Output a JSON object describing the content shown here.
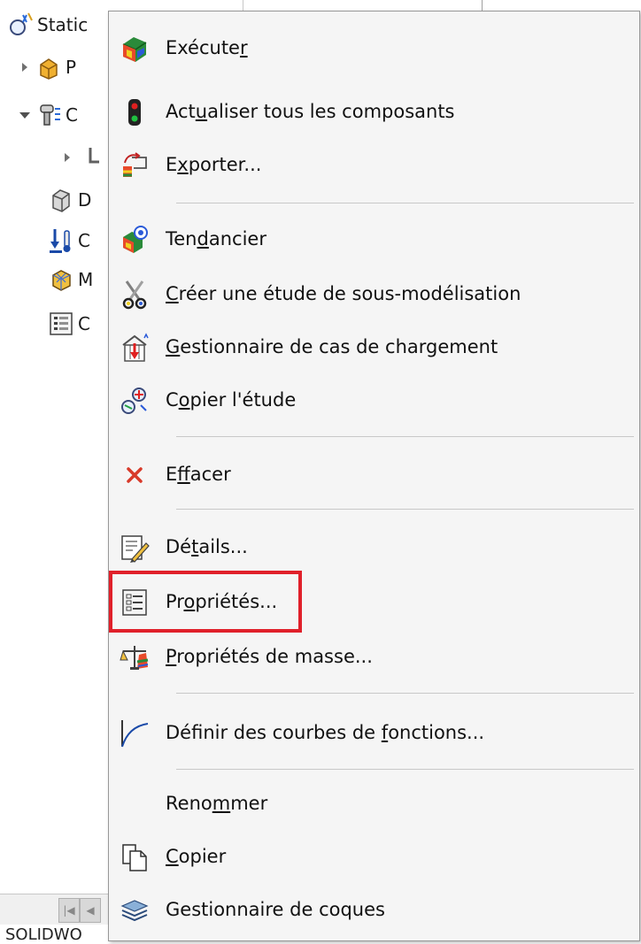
{
  "tree": {
    "title": "Static",
    "rows": [
      {
        "label": "P"
      },
      {
        "label": "C"
      },
      {
        "label": ""
      },
      {
        "label": "D"
      },
      {
        "label": "C"
      },
      {
        "label": "M"
      },
      {
        "label": "C"
      }
    ]
  },
  "status_bar": {
    "text": "SOLIDWO"
  },
  "menu": {
    "items": {
      "executer": {
        "pre": "Exécute",
        "key": "r",
        "post": "",
        "icon": "run-study-icon"
      },
      "actualiser": {
        "pre": "Act",
        "key": "u",
        "post": "aliser tous les composants",
        "icon": "traffic-light-icon"
      },
      "exporter": {
        "pre": "E",
        "key": "x",
        "post": "porter...",
        "icon": "export-icon"
      },
      "tendancier": {
        "pre": "Ten",
        "key": "d",
        "post": "ancier",
        "icon": "trend-tracker-icon"
      },
      "sousmodel": {
        "pre": "",
        "key": "C",
        "post": "réer une étude de sous-modélisation",
        "icon": "scissors-icon"
      },
      "gestcas": {
        "pre": "",
        "key": "G",
        "post": "estionnaire de cas de chargement",
        "icon": "load-case-manager-icon"
      },
      "copieretude": {
        "pre": "C",
        "key": "o",
        "post": "pier l'étude",
        "icon": "copy-study-icon"
      },
      "effacer": {
        "pre": "E",
        "key": "f",
        "post": "facer",
        "icon": "delete-x-icon"
      },
      "details": {
        "pre": "Dé",
        "key": "t",
        "post": "ails...",
        "icon": "details-icon"
      },
      "proprietes": {
        "pre": "Pr",
        "key": "o",
        "post": "priétés...",
        "icon": "properties-icon"
      },
      "propmasse": {
        "pre": "",
        "key": "P",
        "post": "ropriétés de masse...",
        "icon": "mass-properties-icon"
      },
      "courbes": {
        "pre": "Définir des courbes de ",
        "key": "f",
        "post": "onctions...",
        "icon": "function-curve-icon"
      },
      "renommer": {
        "pre": "Reno",
        "key": "m",
        "post": "mer",
        "icon": ""
      },
      "copier": {
        "pre": "",
        "key": "C",
        "post": "opier",
        "icon": "copy-icon"
      },
      "coques": {
        "pre": "Gestionnaire de coques",
        "key": "",
        "post": "",
        "icon": "shell-manager-icon"
      }
    }
  },
  "colors": {
    "highlight": "#e0202a",
    "menu_bg": "#f5f5f5",
    "delete_red": "#d83a2a"
  }
}
